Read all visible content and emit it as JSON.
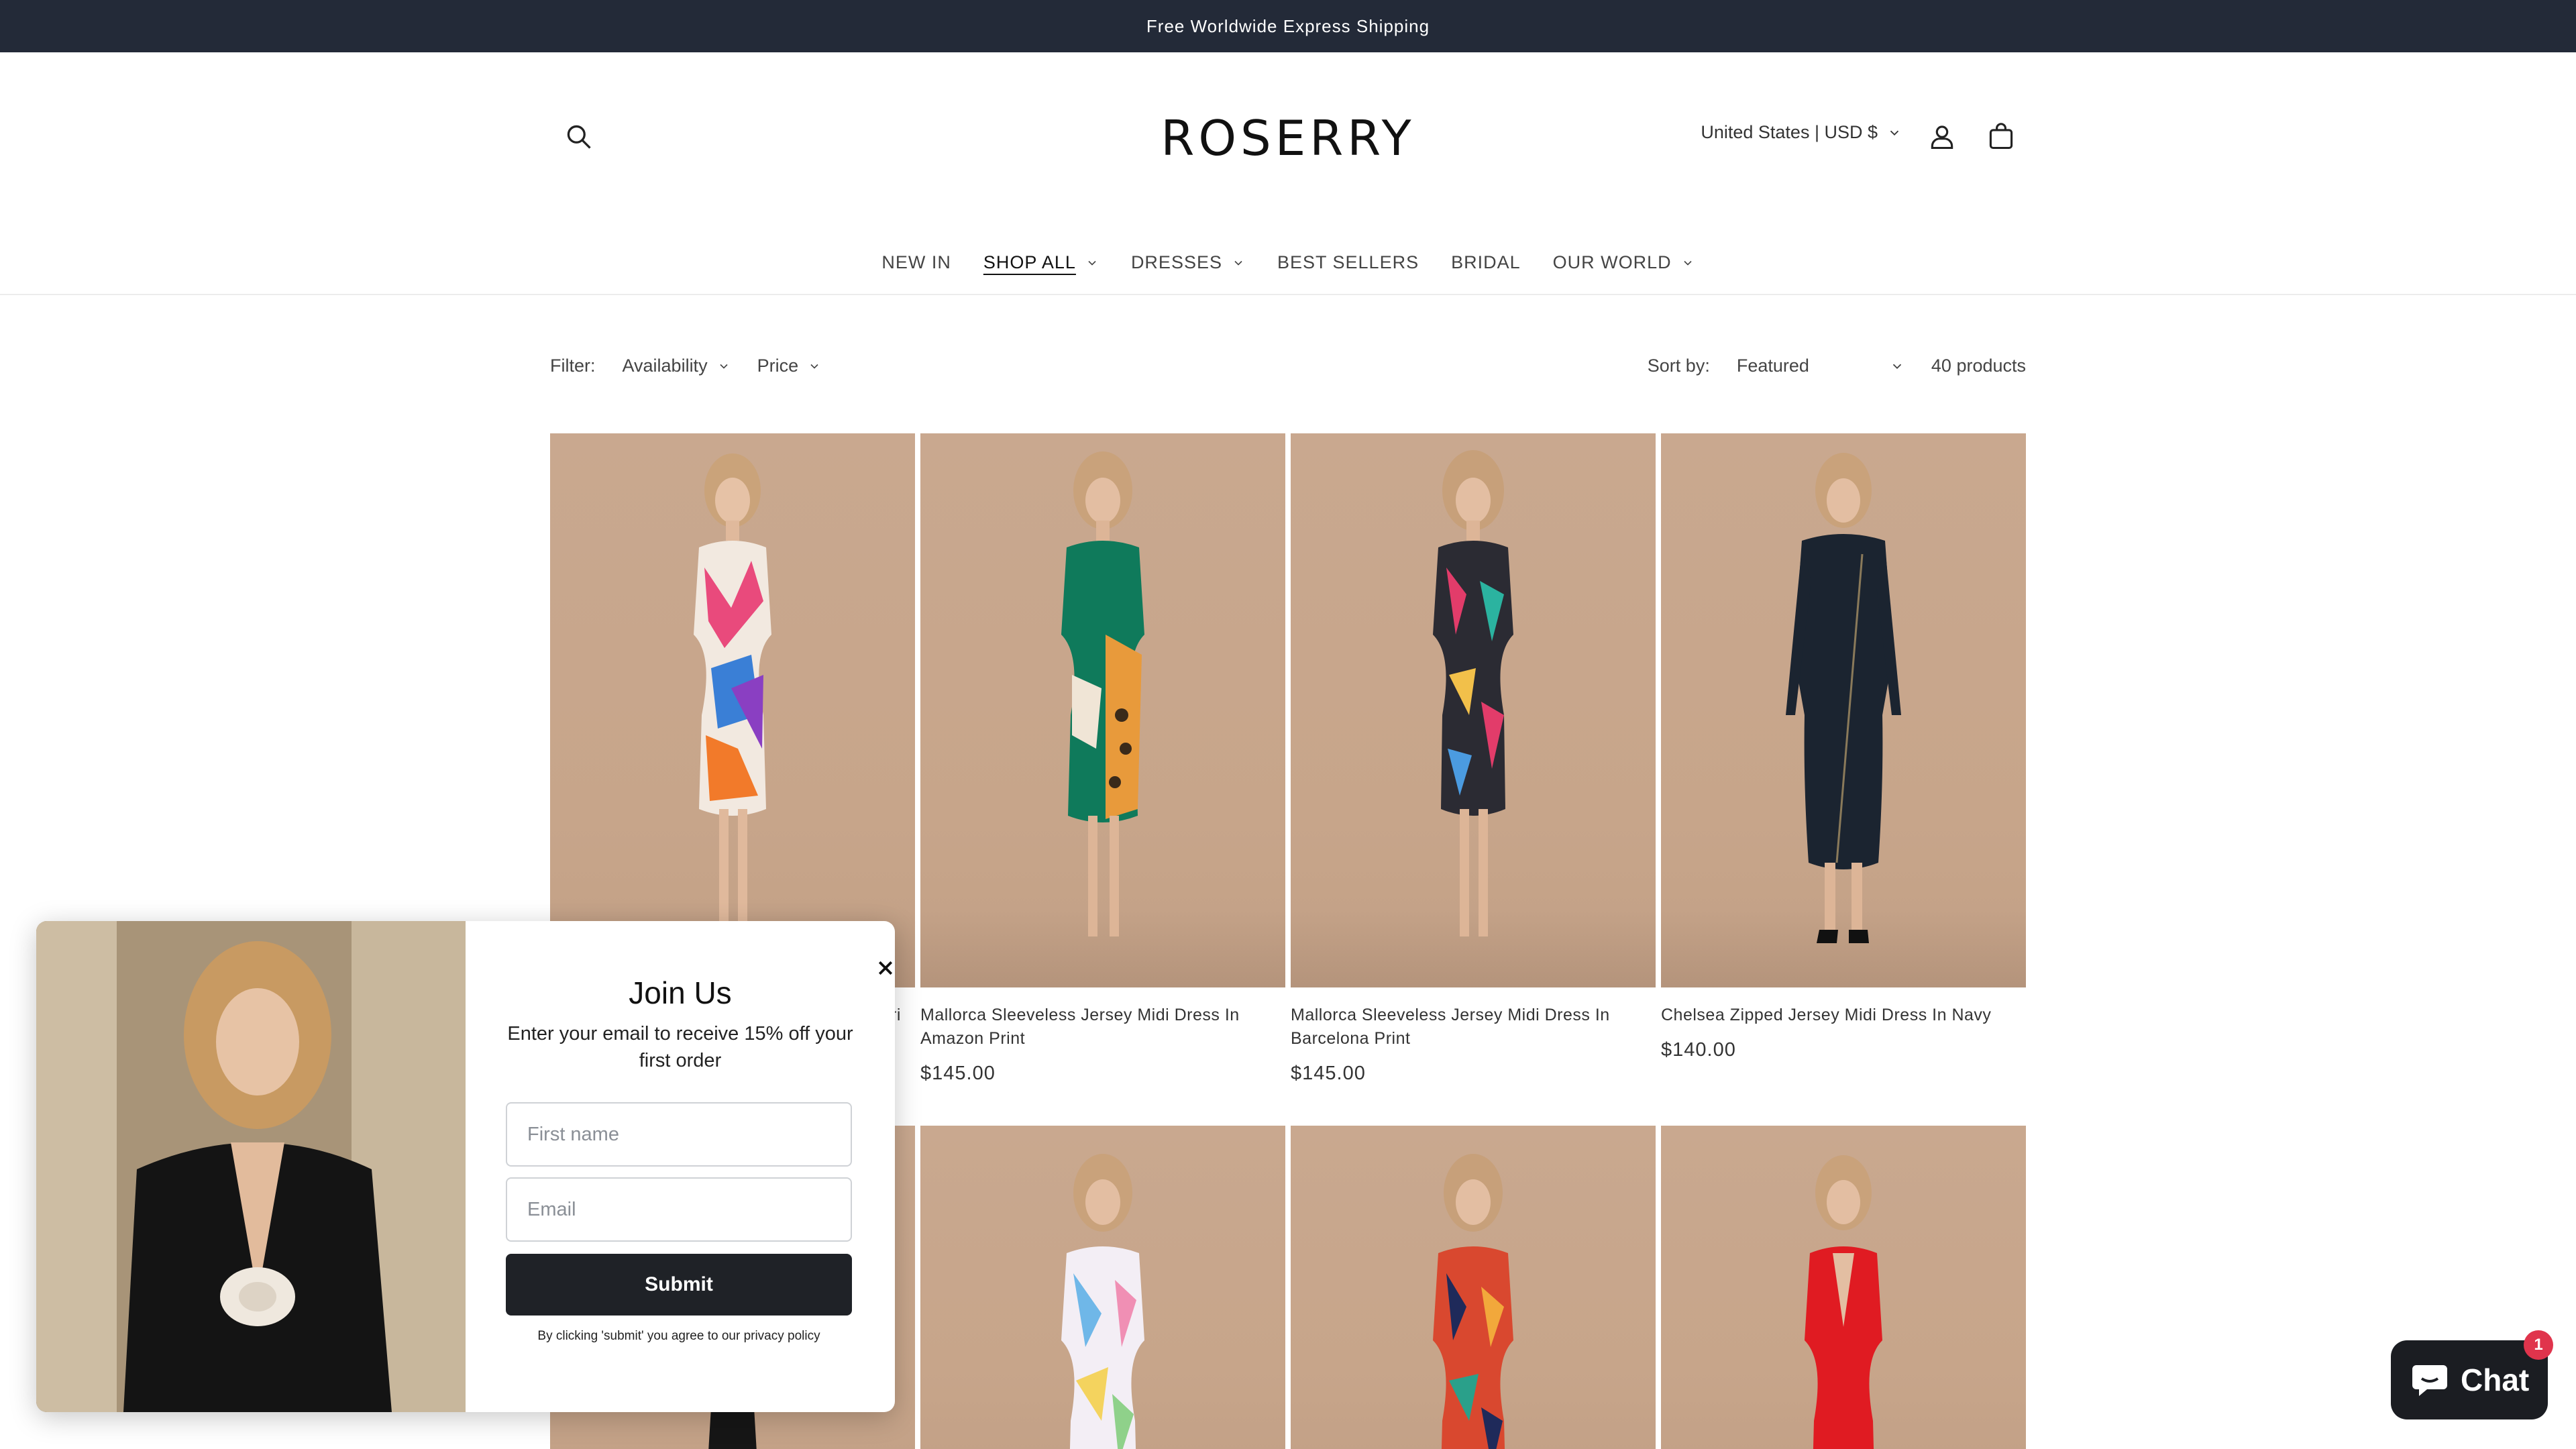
{
  "announcement": "Free Worldwide Express Shipping",
  "header": {
    "logo": "ROSERRY",
    "country_selector": "United States | USD $",
    "icons": [
      "search-icon",
      "account-icon",
      "cart-icon"
    ]
  },
  "nav": {
    "items": [
      {
        "label": "NEW IN",
        "has_dropdown": false
      },
      {
        "label": "SHOP ALL",
        "has_dropdown": true,
        "active": true
      },
      {
        "label": "DRESSES",
        "has_dropdown": true
      },
      {
        "label": "BEST SELLERS",
        "has_dropdown": false
      },
      {
        "label": "BRIDAL",
        "has_dropdown": false
      },
      {
        "label": "OUR WORLD",
        "has_dropdown": true
      }
    ]
  },
  "filters": {
    "label": "Filter:",
    "availability": "Availability",
    "price": "Price",
    "sort_label": "Sort by:",
    "sort_value": "Featured",
    "product_count": "40 products"
  },
  "products": [
    {
      "title": "ri",
      "price": ""
    },
    {
      "title": "Mallorca Sleeveless Jersey Midi Dress In Amazon Print",
      "price": "$145.00"
    },
    {
      "title": "Mallorca Sleeveless Jersey Midi Dress In Barcelona Print",
      "price": "$145.00"
    },
    {
      "title": "Chelsea Zipped Jersey Midi Dress In Navy",
      "price": "$140.00"
    }
  ],
  "popup": {
    "title": "Join Us",
    "subtitle": "Enter your email to receive 15% off your first order",
    "first_name_placeholder": "First name",
    "email_placeholder": "Email",
    "submit_label": "Submit",
    "legal": "By clicking 'submit' you agree to our privacy policy"
  },
  "chat": {
    "label": "Chat",
    "badge": "1"
  },
  "colors": {
    "announcement_bg": "#232a38",
    "photo_backdrop": "#c8a78c",
    "submit_bg": "#1f2227",
    "chat_bg": "#1b1d22",
    "badge": "#e0344c"
  }
}
